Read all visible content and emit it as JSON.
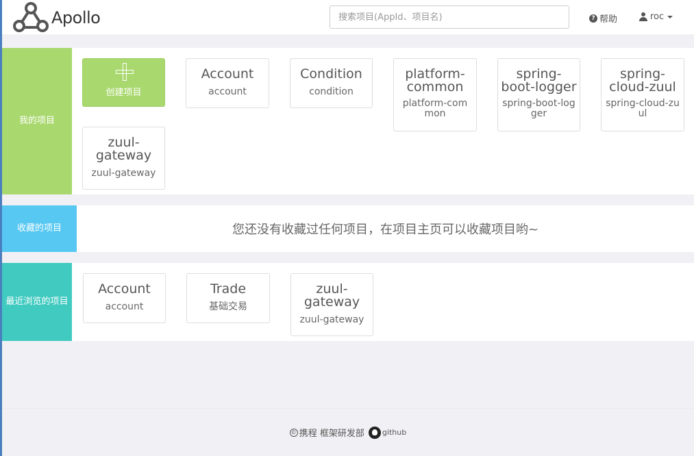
{
  "header": {
    "logo_text": "Apollo",
    "search_placeholder": "搜索项目(AppId、项目名)",
    "help_label": "帮助",
    "user_label": "roc"
  },
  "sections": {
    "mine": {
      "label": "我的项目",
      "create_label": "创建项目",
      "cards": [
        {
          "title": "Account",
          "sub": "account"
        },
        {
          "title": "Condition",
          "sub": "condition"
        },
        {
          "title": "platform-common",
          "sub": "platform-common"
        },
        {
          "title": "spring-boot-logger",
          "sub": "spring-boot-logger"
        },
        {
          "title": "spring-cloud-zuul",
          "sub": "spring-cloud-zuul"
        },
        {
          "title": "zuul-gateway",
          "sub": "zuul-gateway"
        }
      ]
    },
    "favorites": {
      "label": "收藏的项目",
      "empty_text": "您还没有收藏过任何项目，在项目主页可以收藏项目哟~"
    },
    "recent": {
      "label": "最近浏览的项目",
      "cards": [
        {
          "title": "Account",
          "sub": "account"
        },
        {
          "title": "Trade",
          "sub": "基础交易"
        },
        {
          "title": "zuul-gateway",
          "sub": "zuul-gateway"
        }
      ]
    }
  },
  "footer": {
    "copyright_symbol": "©",
    "company": "携程 框架研发部",
    "github_label": "github"
  },
  "colors": {
    "mine_accent": "#a9d86e",
    "favorites_accent": "#57c8f2",
    "recent_accent": "#41cac0"
  }
}
